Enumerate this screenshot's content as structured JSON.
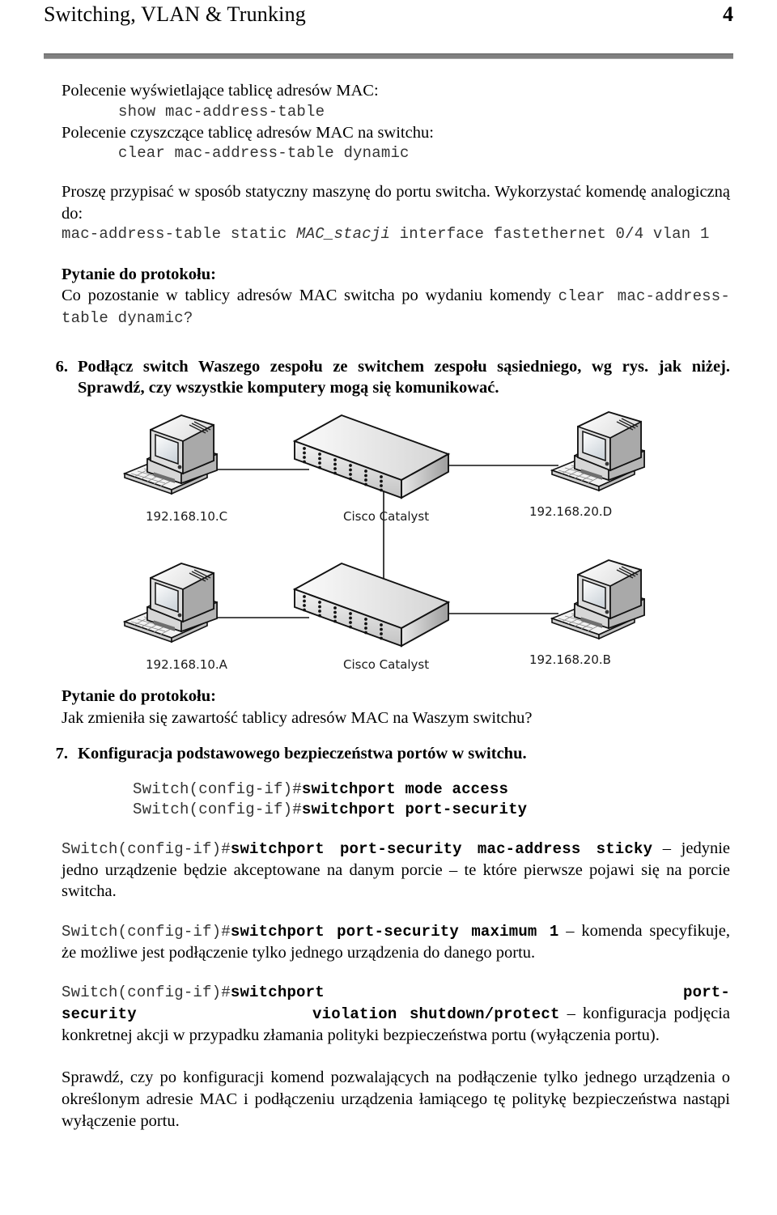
{
  "header": {
    "title": "Switching, VLAN & Trunking",
    "page_number": "4",
    "rule_color": "#808080"
  },
  "section_mac_table": {
    "line1": "Polecenie wyświetlające tablicę adresów MAC:",
    "cmd1": "show mac-address-table",
    "line2": "Polecenie czyszczące tablicę adresów MAC na switchu:",
    "cmd2": "clear mac-address-table dynamic"
  },
  "section_static": {
    "paragraph": "Proszę przypisać w sposób statyczny maszynę do portu switcha. Wykorzystać komendę analogiczną do:",
    "cmd_part1": "mac-address-table static ",
    "cmd_italic": "MAC_stacji",
    "cmd_part2": " interface fastethernet 0/4 vlan 1"
  },
  "question_1": {
    "label": "Pytanie do protokołu:",
    "text_before": "Co pozostanie w tablicy adresów MAC switcha po wydaniu komendy ",
    "command": "clear mac-address-table dynamic",
    "text_after": "?"
  },
  "item_6": {
    "number": "6.",
    "text": "Podłącz switch Waszego zespołu ze switchem zespołu sąsiedniego, wg rys. jak niżej. Sprawdź, czy wszystkie komputery mogą się komunikować."
  },
  "diagram": {
    "labels": {
      "pc_top_left": "192.168.10.C",
      "switch_top": "Cisco Catalyst",
      "pc_top_right": "192.168.20.D",
      "pc_bottom_left": "192.168.10.A",
      "switch_bottom": "Cisco Catalyst",
      "pc_bottom_right": "192.168.20.B"
    },
    "nodes": [
      {
        "name": "pc-top-left",
        "type": "desktop-computer"
      },
      {
        "name": "switch-top",
        "type": "network-switch"
      },
      {
        "name": "pc-top-right",
        "type": "desktop-computer"
      },
      {
        "name": "pc-bottom-left",
        "type": "desktop-computer"
      },
      {
        "name": "switch-bottom",
        "type": "network-switch"
      },
      {
        "name": "pc-bottom-right",
        "type": "desktop-computer"
      }
    ],
    "links": [
      "pc-top-left -- switch-top",
      "switch-top -- pc-top-right",
      "switch-top -- switch-bottom",
      "pc-bottom-left -- switch-bottom",
      "switch-bottom -- pc-bottom-right"
    ]
  },
  "question_2": {
    "label": "Pytanie do protokołu:",
    "text": "Jak zmieniła się zawartość tablicy adresów MAC na Waszym switchu?"
  },
  "item_7": {
    "number": "7.",
    "text": "Konfiguracja podstawowego bezpieczeństwa portów w switchu."
  },
  "commands": {
    "prompt": "Switch(config-if)#",
    "cmd_mode_access": "switchport mode access",
    "cmd_port_security": "switchport port-security",
    "cmd_sticky": "switchport port-security mac-address sticky",
    "sticky_desc": " – jedynie jedno urządzenie będzie akceptowane na danym porcie – te które pierwsze pojawi się na porcie switcha.",
    "cmd_maximum": "switchport port-security maximum 1",
    "maximum_desc": " – komenda specyfikuje, że możliwe jest podłączenie tylko jednego urządzenia do danego portu.",
    "cmd_violation_a": "switchport",
    "cmd_violation_b": "port-security",
    "cmd_violation_c": "violation",
    "cmd_violation_d": "shutdown/protect",
    "violation_desc": " – konfiguracja podjęcia konkretnej akcji w przypadku złamania polityki bezpieczeństwa portu (wyłączenia portu)."
  },
  "closing": {
    "text": "Sprawdź, czy po konfiguracji komend pozwalających na podłączenie tylko jednego urządzenia o określonym adresie MAC i podłączeniu urządzenia łamiącego tę politykę bezpieczeństwa nastąpi wyłączenie portu."
  }
}
